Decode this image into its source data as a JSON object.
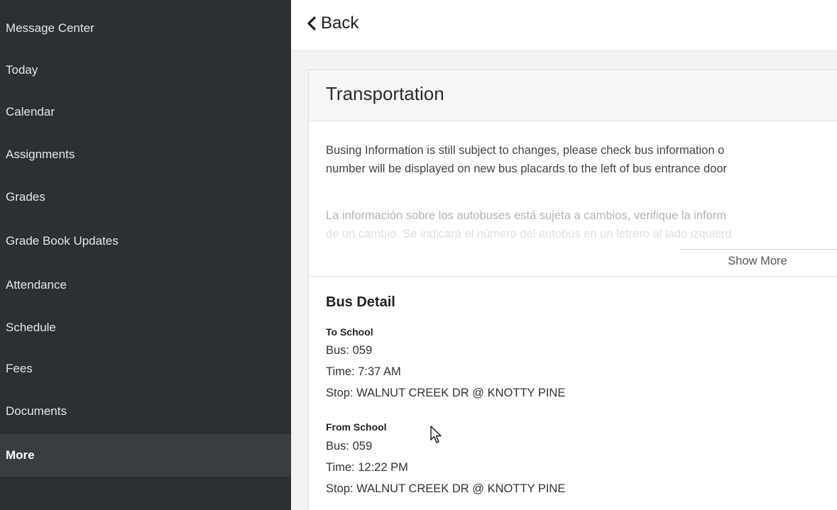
{
  "sidebar": {
    "items": [
      {
        "label": "Message Center"
      },
      {
        "label": "Today"
      },
      {
        "label": "Calendar"
      },
      {
        "label": "Assignments"
      },
      {
        "label": "Grades"
      },
      {
        "label": "Grade Book Updates"
      },
      {
        "label": "Attendance"
      },
      {
        "label": "Schedule"
      },
      {
        "label": "Fees"
      },
      {
        "label": "Documents"
      },
      {
        "label": "More"
      }
    ],
    "active": "More"
  },
  "header": {
    "back_label": "Back",
    "back_icon": "chevron-left-icon"
  },
  "card": {
    "title": "Transportation",
    "notice_en_line1": "Busing Information is still subject to changes, please check bus information o",
    "notice_en_line2": "number will be displayed on new bus placards to the left of bus entrance door",
    "notice_es_line1": "La información sobre los autobuses está sujeta a cambios, verifique la inform",
    "notice_es_line2": "de un cambio. Se indicará el número del autobús en un letrero al lado izquierd",
    "show_more_label": "Show More"
  },
  "bus_detail": {
    "title": "Bus Detail",
    "to_school": {
      "label": "To School",
      "bus": "Bus: 059",
      "time": "Time: 7:37 AM",
      "stop": "Stop: WALNUT CREEK DR @ KNOTTY PINE"
    },
    "from_school": {
      "label": "From School",
      "bus": "Bus: 059",
      "time": "Time: 12:22 PM",
      "stop": "Stop: WALNUT CREEK DR @ KNOTTY PINE"
    }
  },
  "colors": {
    "sidebar_bg": "#2b3035",
    "sidebar_active_bg": "#383d42",
    "main_bg": "#f3f3f3"
  }
}
